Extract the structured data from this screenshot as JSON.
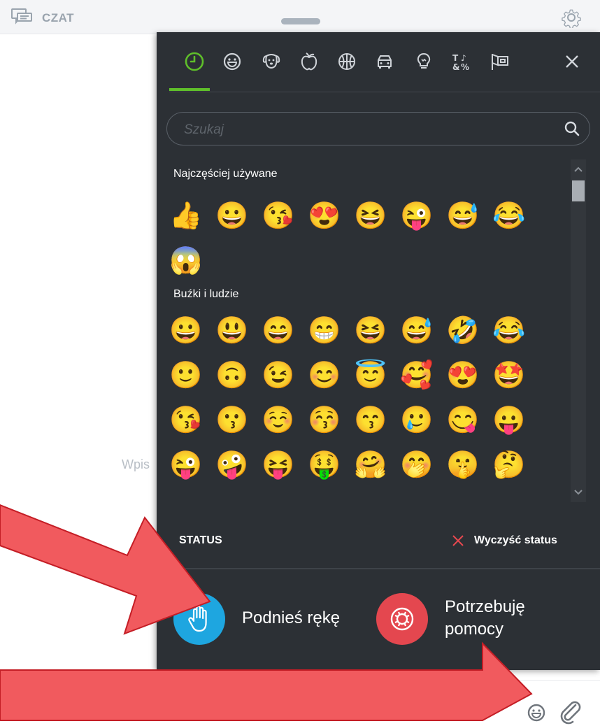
{
  "header": {
    "title": "CZAT",
    "logo_icon": "chat-bubbles-icon",
    "settings_icon": "gear-icon"
  },
  "background": {
    "placeholder_fragment": "Wpis"
  },
  "composer": {
    "placeholder": "Wpisz wiadomość",
    "emoji_icon": "smiley-icon",
    "attach_icon": "paperclip-icon"
  },
  "picker": {
    "category_tabs": [
      {
        "name": "recent",
        "icon": "clock-icon",
        "active": true
      },
      {
        "name": "smileys",
        "icon": "smiley-icon"
      },
      {
        "name": "animals",
        "icon": "dog-icon"
      },
      {
        "name": "food",
        "icon": "apple-icon"
      },
      {
        "name": "activities",
        "icon": "basketball-icon"
      },
      {
        "name": "travel",
        "icon": "car-icon"
      },
      {
        "name": "objects",
        "icon": "lightbulb-icon"
      },
      {
        "name": "symbols",
        "icon": "symbols-icon"
      },
      {
        "name": "flags",
        "icon": "flag-icon"
      }
    ],
    "close_icon": "close-icon",
    "search_placeholder": "Szukaj",
    "sections": [
      {
        "label": "Najczęściej używane",
        "emojis": [
          "👍",
          "😀",
          "😘",
          "😍",
          "😆",
          "😜",
          "😅",
          "😂",
          "😱"
        ]
      },
      {
        "label": "Buźki i ludzie",
        "emojis": [
          "😀",
          "😃",
          "😄",
          "😁",
          "😆",
          "😅",
          "🤣",
          "😂",
          "🙂",
          "🙃",
          "😉",
          "😊",
          "😇",
          "🥰",
          "😍",
          "🤩",
          "😘",
          "😗",
          "☺️",
          "😚",
          "😙",
          "🥲",
          "😋",
          "😛",
          "😜",
          "🤪",
          "😝",
          "🤑",
          "🤗",
          "🤭",
          "🤫",
          "🤔"
        ]
      }
    ],
    "status": {
      "label": "STATUS",
      "clear_label": "Wyczyść status"
    },
    "raise_hand": {
      "label": "Podnieś rękę",
      "icon": "hand-icon",
      "color": "#1ea6e0"
    },
    "need_help": {
      "line1": "Potrzebuję",
      "line2": "pomocy",
      "icon": "lifebuoy-icon",
      "color": "#e4474f"
    },
    "accent": "#5fbf2a",
    "panel_bg": "#2c3035"
  },
  "annotation": {
    "arrow_color": "#f15a5e"
  }
}
